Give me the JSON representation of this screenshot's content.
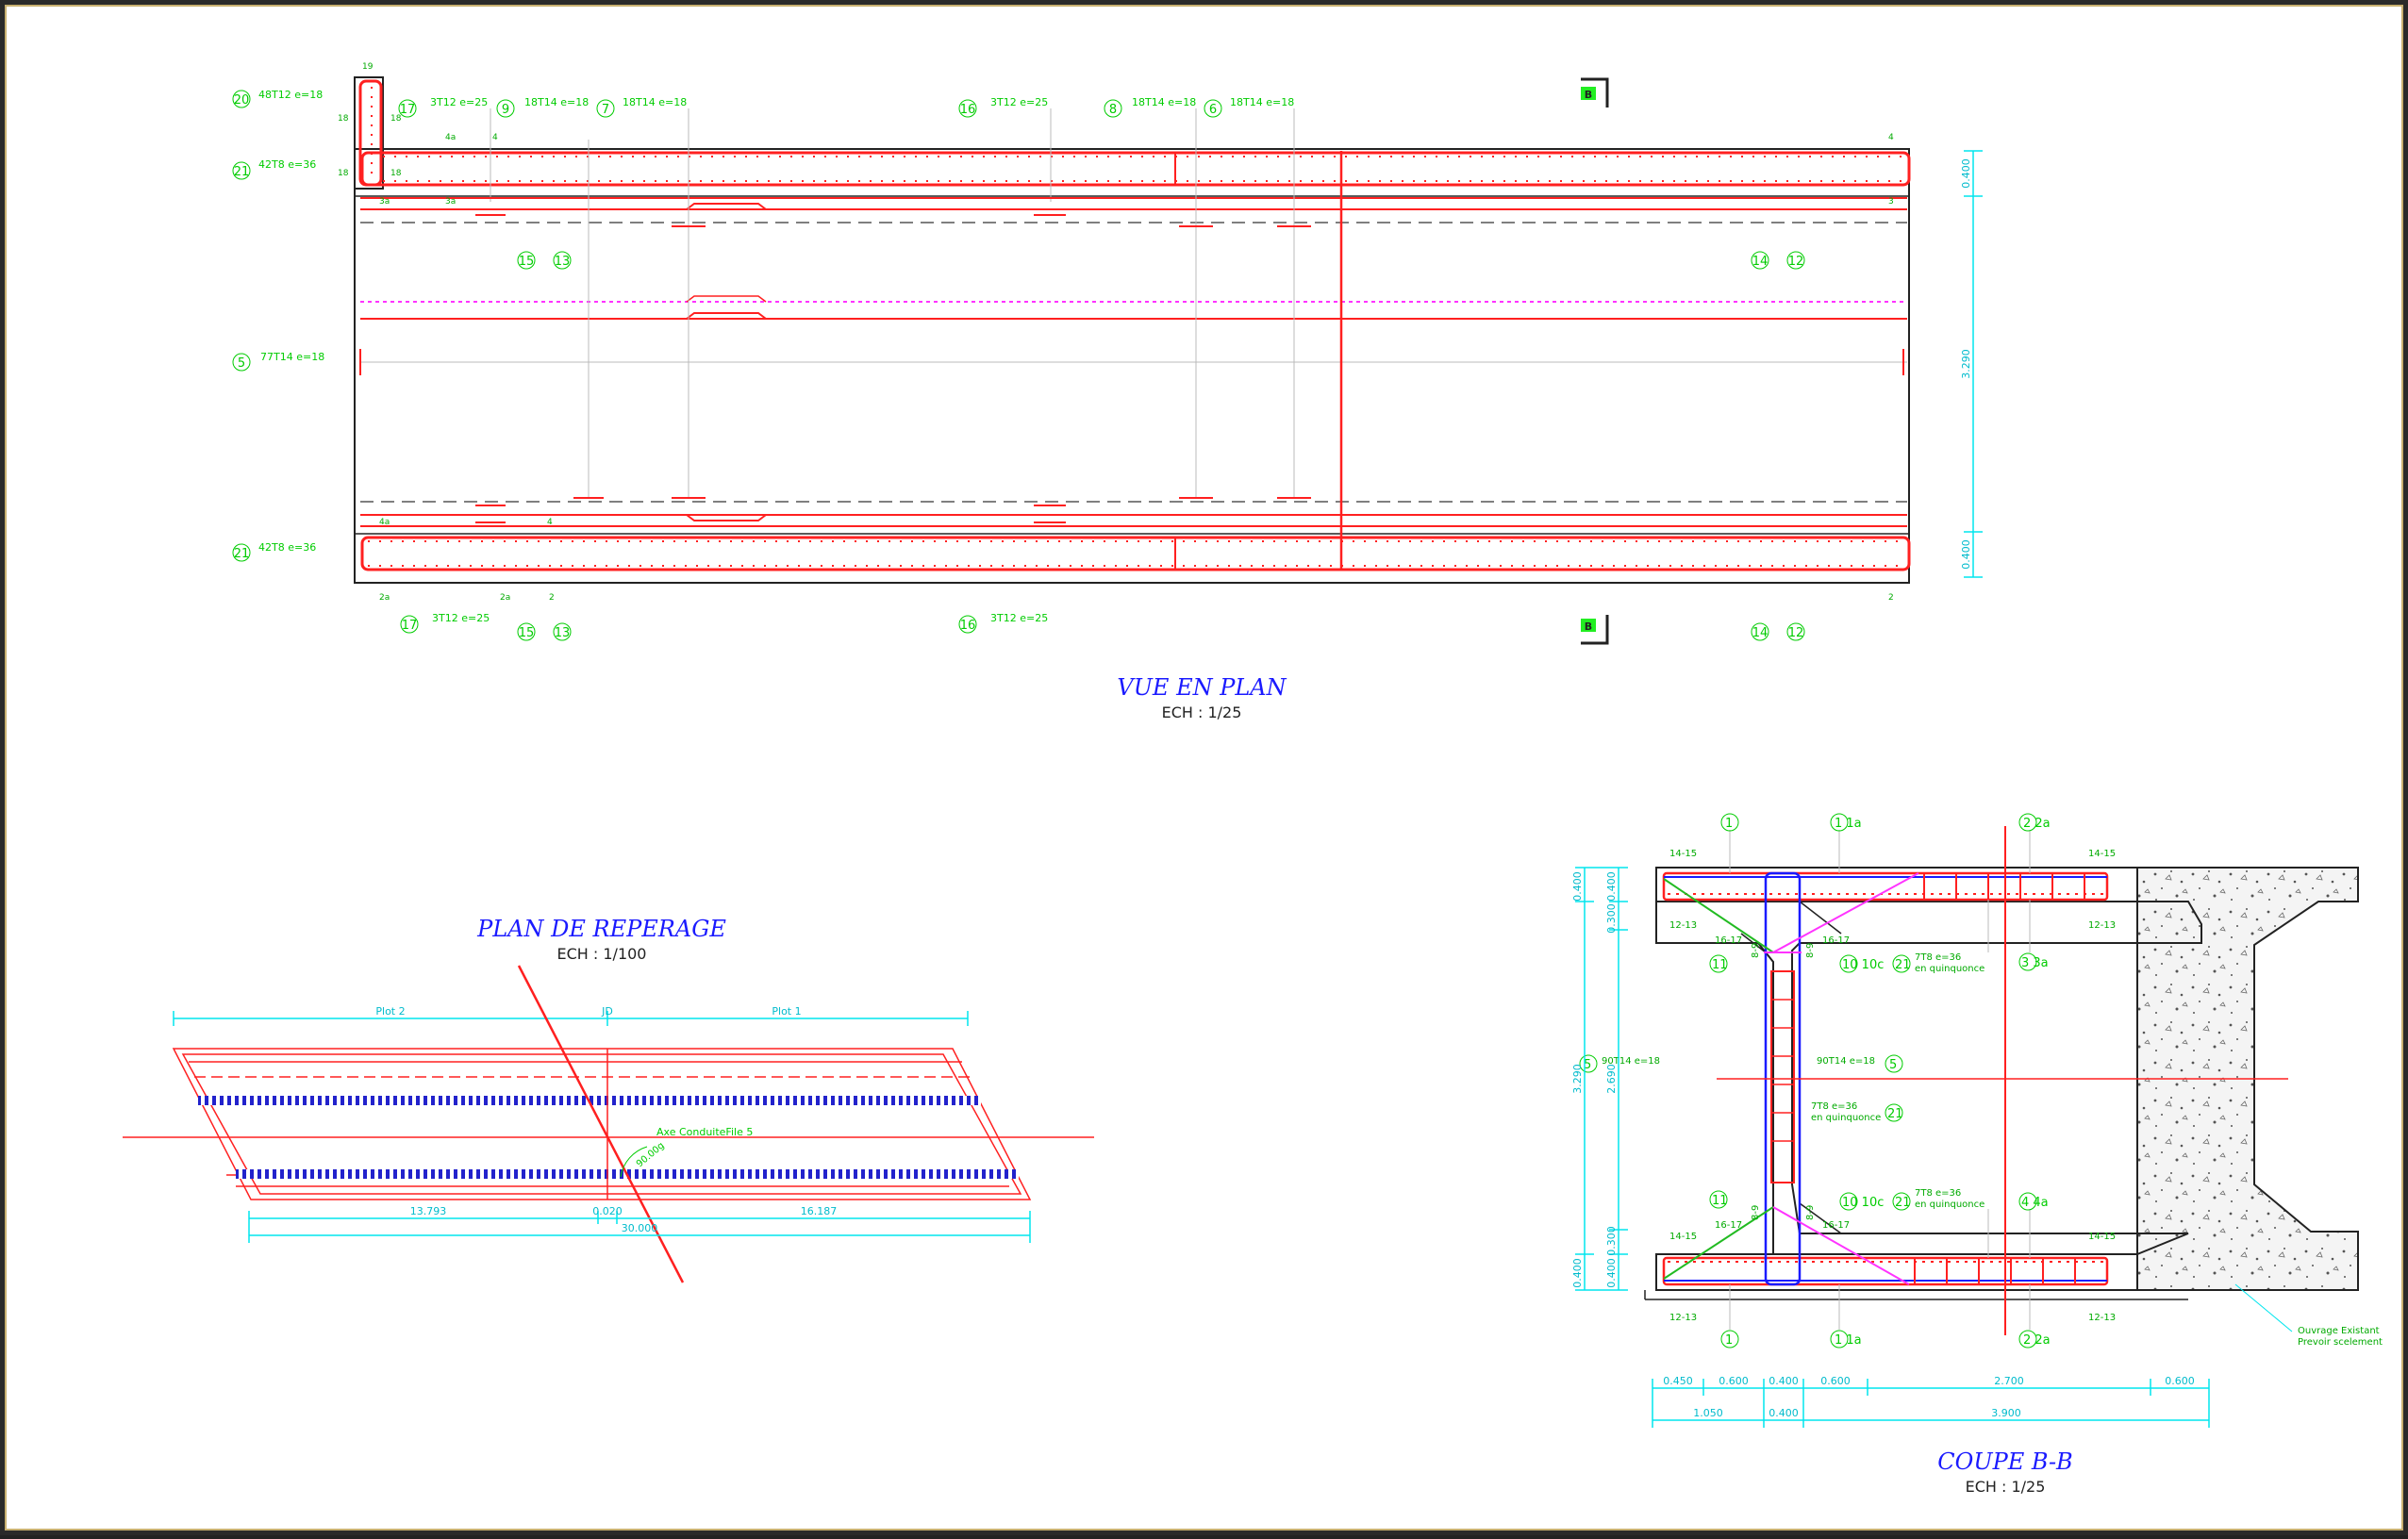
{
  "colors": {
    "rebar": "#ff2020",
    "label": "#00dd00",
    "dim": "#00e5ee",
    "title": "#1a1aff",
    "pink": "#ff33ff",
    "blue": "#2222cc",
    "green": "#22bb22",
    "grey": "#888888",
    "bg": "#ffffff"
  },
  "plan": {
    "title": "VUE EN PLAN",
    "scale": "ECH : 1/25",
    "section_marker": "B",
    "marks": {
      "m20": "20",
      "m21": "21",
      "m17": "17",
      "m9": "9",
      "m7": "7",
      "m16": "16",
      "m8": "8",
      "m6": "6",
      "m15": "15",
      "m13": "13",
      "m14": "14",
      "m12": "12",
      "m5": "5"
    },
    "specs": {
      "s20": "48T12  e=18",
      "s21": "42T8  e=36",
      "s17": "3T12  e=25",
      "s9": "18T14  e=18",
      "s7": "18T14  e=18",
      "s16": "3T12  e=25",
      "s8": "18T14  e=18",
      "s6": "18T14  e=18",
      "s5": "77T14  e=18"
    },
    "small": {
      "n19": "19",
      "n18": "18",
      "n4a": "4a",
      "n4": "4",
      "n3a": "3a",
      "n3": "3",
      "n2a": "2a",
      "n2": "2",
      "n1": "1"
    },
    "dims": {
      "top": "0.400",
      "mid": "3.290",
      "bot": "0.400"
    }
  },
  "reperage": {
    "title": "PLAN DE REPERAGE",
    "scale": "ECH : 1/100",
    "plot2": "Plot 2",
    "joint": "JD",
    "plot1": "Plot 1",
    "axis_label": "Axe ConduiteFile 5",
    "angle": "90.00g",
    "dims": {
      "d1": "13.793",
      "d2": "0.020",
      "d3": "16.187",
      "total": "30.000"
    }
  },
  "coupe": {
    "title": "COUPE B-B",
    "scale": "ECH : 1/25",
    "marks": {
      "c1": "1",
      "c1a": "1 1a",
      "c2": "2 2a",
      "c11": "11",
      "c10": "10 10c",
      "c3": "3 3a",
      "c5": "5",
      "c4": "4 4a",
      "c21": "21"
    },
    "texts": {
      "t1415": "14-15",
      "t1213": "12-13",
      "t1617": "16-17",
      "t89": "8-9",
      "t7t8": "7T8  e=36",
      "quinc": "en quinquonce",
      "t90": "90T14  e=18",
      "existant1": "Ouvrage Existant",
      "existant2": "Prevoir scelement"
    },
    "vdims_outer": {
      "a": "0.400",
      "b": "3.290",
      "c": "0.400"
    },
    "vdims_inner": {
      "a": "0.400",
      "b": "0.300",
      "c": "2.690",
      "d": "0.300",
      "e": "0.400"
    },
    "hdims_row1": [
      "0.450",
      "0.600",
      "0.400",
      "0.600",
      "2.700",
      "0.600"
    ],
    "hdims_row2": [
      "1.050",
      "0.400",
      "3.900"
    ]
  }
}
